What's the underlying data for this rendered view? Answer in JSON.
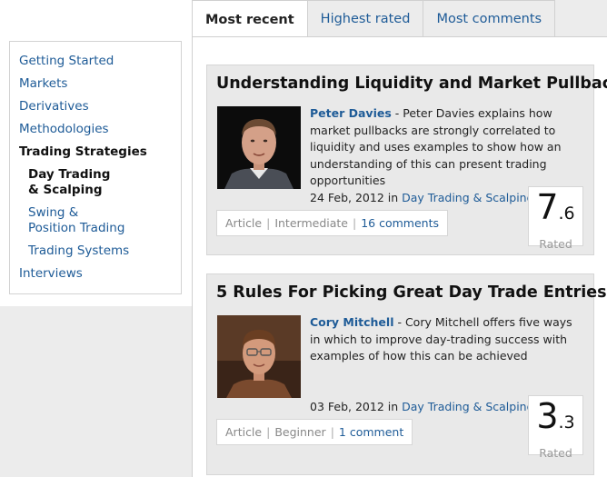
{
  "nav": {
    "items": [
      {
        "label": "Getting Started"
      },
      {
        "label": "Markets"
      },
      {
        "label": "Derivatives"
      },
      {
        "label": "Methodologies"
      },
      {
        "label": "Trading Strategies"
      },
      {
        "label": "Day Trading & Scalping"
      },
      {
        "label": "Swing & Position Trading"
      },
      {
        "label": "Trading Systems"
      },
      {
        "label": "Interviews"
      }
    ]
  },
  "tabs": [
    {
      "label": "Most recent"
    },
    {
      "label": "Highest rated"
    },
    {
      "label": "Most comments"
    }
  ],
  "articles": [
    {
      "title": "Understanding Liquidity and Market Pullbacks",
      "author": "Peter Davies",
      "summary": " - Peter Davies explains how market pullbacks are strongly correlated to liquidity and uses examples to show how an understanding of this can present trading opportunities",
      "date": "24 Feb, 2012",
      "in": " in ",
      "category": "Day Trading & Scalping",
      "type": "Article",
      "sep": "|",
      "level": "Intermediate",
      "comments": "16 comments",
      "rating_int": "7",
      "rating_dec": ".6",
      "rated": "Rated"
    },
    {
      "title": "5 Rules For Picking Great Day Trade Entries",
      "author": "Cory Mitchell",
      "summary": " - Cory Mitchell offers five ways in which to improve day-trading success with examples of how this can be achieved",
      "date": "03 Feb, 2012",
      "in": " in ",
      "category": "Day Trading & Scalping",
      "type": "Article",
      "sep": "|",
      "level": "Beginner",
      "comments": "1 comment",
      "rating_int": "3",
      "rating_dec": ".3",
      "rated": "Rated"
    }
  ]
}
